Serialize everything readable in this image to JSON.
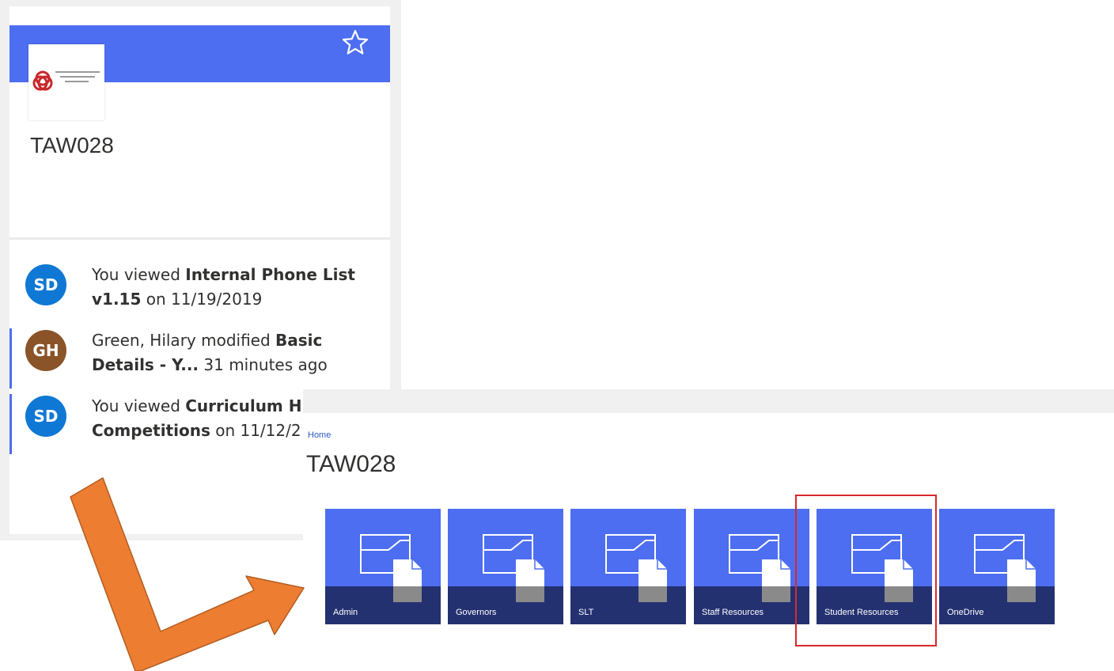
{
  "card": {
    "title": "TAW028",
    "colors": {
      "header": "#4d6ef0",
      "accent_border": "#4d6ef0"
    },
    "icons": {
      "favorite": "star-outline-icon",
      "logo": "school-logo"
    },
    "activities": [
      {
        "initials": "SD",
        "avatar_color": "#0f78d4",
        "lines": [
          [
            {
              "t": "You viewed ",
              "b": false
            },
            {
              "t": "Internal Phone List",
              "b": true
            }
          ],
          [
            {
              "t": "v1.15",
              "b": true
            },
            {
              "t": " on 11/19/2019",
              "b": false
            }
          ]
        ]
      },
      {
        "initials": "GH",
        "avatar_color": "#8a5328",
        "lines": [
          [
            {
              "t": "Green, Hilary modified ",
              "b": false
            },
            {
              "t": "Basic",
              "b": true
            }
          ],
          [
            {
              "t": "Details - Y...",
              "b": true
            },
            {
              "t": " 31 minutes ago",
              "b": false
            }
          ]
        ]
      },
      {
        "initials": "SD",
        "avatar_color": "#0f78d4",
        "lines": [
          [
            {
              "t": "You viewed ",
              "b": false
            },
            {
              "t": "Curriculum H",
              "b": true
            }
          ],
          [
            {
              "t": "Competitions",
              "b": true
            },
            {
              "t": " on 11/12/2",
              "b": false
            }
          ]
        ]
      }
    ]
  },
  "site": {
    "breadcrumb": "Home",
    "title": "TAW028",
    "tiles": [
      {
        "label": "Admin",
        "icon": "folder-document-icon"
      },
      {
        "label": "Governors",
        "icon": "folder-document-icon"
      },
      {
        "label": "SLT",
        "icon": "folder-document-icon"
      },
      {
        "label": "Staff Resources",
        "icon": "folder-document-icon"
      },
      {
        "label": "Student Resources",
        "icon": "folder-document-icon"
      },
      {
        "label": "OneDrive",
        "icon": "folder-document-icon"
      }
    ],
    "highlighted_tile": "Student Resources",
    "colors": {
      "tile": "#4d6ef0",
      "tile_band": "#243171",
      "highlight": "#d9282b",
      "arrow": "#ed7d31"
    }
  }
}
